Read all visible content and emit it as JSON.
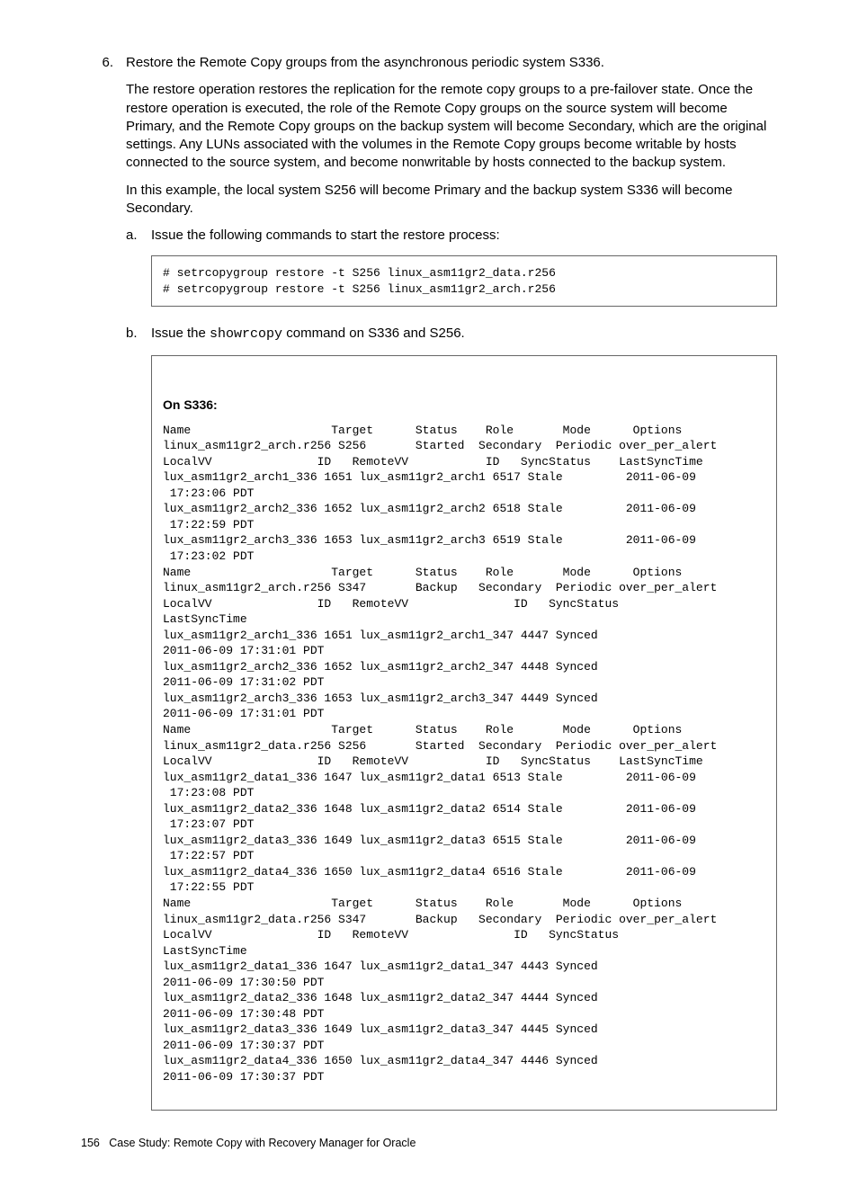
{
  "step": {
    "number": "6.",
    "title": "Restore the Remote Copy groups from the asynchronous periodic system S336.",
    "para1": "The restore operation restores the replication for the remote copy groups to a pre-failover state. Once the restore operation is executed, the role of the Remote Copy groups on the source system will become Primary, and the Remote Copy groups on the backup system will become Secondary, which are the original settings. Any LUNs associated with the volumes in the Remote Copy groups become writable by hosts connected to the source system, and become nonwritable by hosts connected to the backup system.",
    "para2": "In this example, the local system S256 will become Primary and the backup system S336 will become Secondary.",
    "sub_a": {
      "marker": "a.",
      "text": "Issue the following commands to start the restore process:",
      "code": "# setrcopygroup restore -t S256 linux_asm11gr2_data.r256\n# setrcopygroup restore -t S256 linux_asm11gr2_arch.r256"
    },
    "sub_b": {
      "marker": "b.",
      "pre": "Issue the ",
      "cmd": "showrcopy",
      "post": " command on S336 and S256.",
      "heading": "On S336:",
      "code": "Name                    Target      Status    Role       Mode      Options\nlinux_asm11gr2_arch.r256 S256       Started  Secondary  Periodic over_per_alert\nLocalVV               ID   RemoteVV           ID   SyncStatus    LastSyncTime\nlux_asm11gr2_arch1_336 1651 lux_asm11gr2_arch1 6517 Stale         2011-06-09\n 17:23:06 PDT\nlux_asm11gr2_arch2_336 1652 lux_asm11gr2_arch2 6518 Stale         2011-06-09\n 17:22:59 PDT\nlux_asm11gr2_arch3_336 1653 lux_asm11gr2_arch3 6519 Stale         2011-06-09\n 17:23:02 PDT\nName                    Target      Status    Role       Mode      Options\nlinux_asm11gr2_arch.r256 S347       Backup   Secondary  Periodic over_per_alert\nLocalVV               ID   RemoteVV               ID   SyncStatus\nLastSyncTime\nlux_asm11gr2_arch1_336 1651 lux_asm11gr2_arch1_347 4447 Synced\n2011-06-09 17:31:01 PDT\nlux_asm11gr2_arch2_336 1652 lux_asm11gr2_arch2_347 4448 Synced\n2011-06-09 17:31:02 PDT\nlux_asm11gr2_arch3_336 1653 lux_asm11gr2_arch3_347 4449 Synced\n2011-06-09 17:31:01 PDT\nName                    Target      Status    Role       Mode      Options\nlinux_asm11gr2_data.r256 S256       Started  Secondary  Periodic over_per_alert\nLocalVV               ID   RemoteVV           ID   SyncStatus    LastSyncTime\nlux_asm11gr2_data1_336 1647 lux_asm11gr2_data1 6513 Stale         2011-06-09\n 17:23:08 PDT\nlux_asm11gr2_data2_336 1648 lux_asm11gr2_data2 6514 Stale         2011-06-09\n 17:23:07 PDT\nlux_asm11gr2_data3_336 1649 lux_asm11gr2_data3 6515 Stale         2011-06-09\n 17:22:57 PDT\nlux_asm11gr2_data4_336 1650 lux_asm11gr2_data4 6516 Stale         2011-06-09\n 17:22:55 PDT\nName                    Target      Status    Role       Mode      Options\nlinux_asm11gr2_data.r256 S347       Backup   Secondary  Periodic over_per_alert\nLocalVV               ID   RemoteVV               ID   SyncStatus\nLastSyncTime\nlux_asm11gr2_data1_336 1647 lux_asm11gr2_data1_347 4443 Synced\n2011-06-09 17:30:50 PDT\nlux_asm11gr2_data2_336 1648 lux_asm11gr2_data2_347 4444 Synced\n2011-06-09 17:30:48 PDT\nlux_asm11gr2_data3_336 1649 lux_asm11gr2_data3_347 4445 Synced\n2011-06-09 17:30:37 PDT\nlux_asm11gr2_data4_336 1650 lux_asm11gr2_data4_347 4446 Synced\n2011-06-09 17:30:37 PDT"
    }
  },
  "footer": {
    "page": "156",
    "title": "Case Study: Remote Copy with Recovery Manager for Oracle"
  }
}
